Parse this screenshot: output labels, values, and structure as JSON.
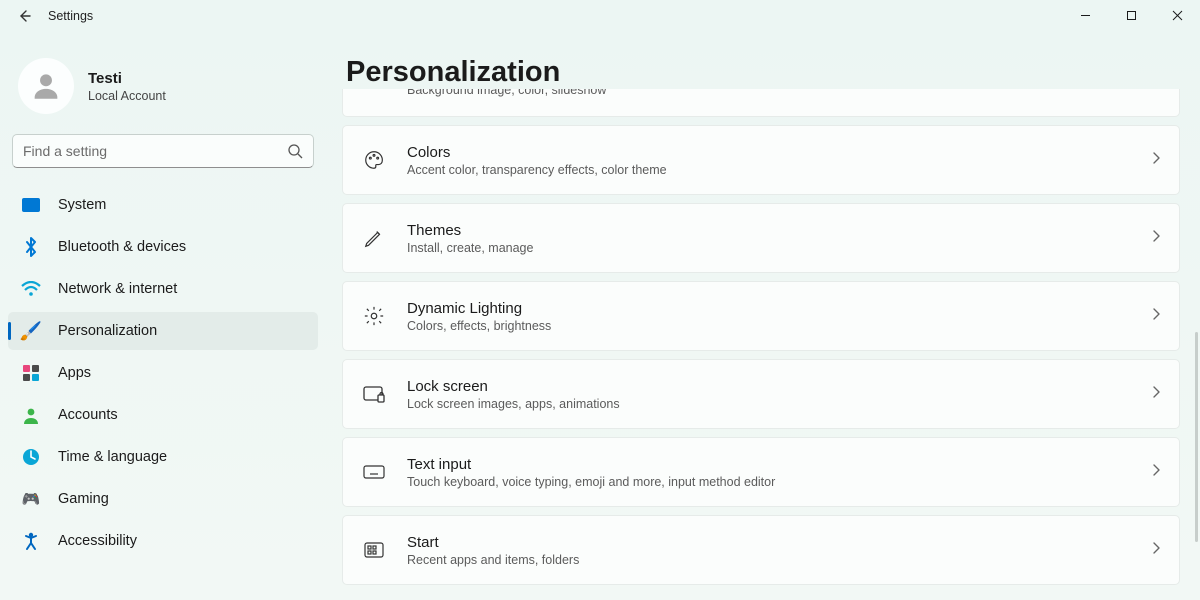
{
  "window": {
    "title": "Settings"
  },
  "user": {
    "name": "Testi",
    "subtitle": "Local Account"
  },
  "search": {
    "placeholder": "Find a setting"
  },
  "nav": {
    "items": [
      {
        "id": "system",
        "label": "System"
      },
      {
        "id": "bluetooth",
        "label": "Bluetooth & devices"
      },
      {
        "id": "network",
        "label": "Network & internet"
      },
      {
        "id": "personalization",
        "label": "Personalization",
        "selected": true
      },
      {
        "id": "apps",
        "label": "Apps"
      },
      {
        "id": "accounts",
        "label": "Accounts"
      },
      {
        "id": "time",
        "label": "Time & language"
      },
      {
        "id": "gaming",
        "label": "Gaming"
      },
      {
        "id": "accessibility",
        "label": "Accessibility"
      }
    ]
  },
  "page": {
    "title": "Personalization",
    "cards": [
      {
        "id": "background",
        "title": "",
        "subtitle": "Background image, color, slideshow",
        "partial_top": true
      },
      {
        "id": "colors",
        "title": "Colors",
        "subtitle": "Accent color, transparency effects, color theme"
      },
      {
        "id": "themes",
        "title": "Themes",
        "subtitle": "Install, create, manage"
      },
      {
        "id": "dynamic",
        "title": "Dynamic Lighting",
        "subtitle": "Colors, effects, brightness"
      },
      {
        "id": "lock",
        "title": "Lock screen",
        "subtitle": "Lock screen images, apps, animations"
      },
      {
        "id": "textinput",
        "title": "Text input",
        "subtitle": "Touch keyboard, voice typing, emoji and more, input method editor"
      },
      {
        "id": "start",
        "title": "Start",
        "subtitle": "Recent apps and items, folders"
      }
    ]
  }
}
